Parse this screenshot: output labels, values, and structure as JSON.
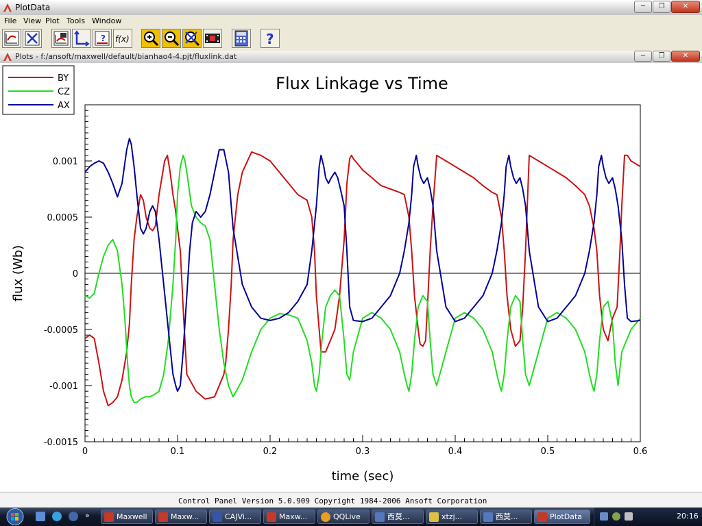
{
  "app": {
    "title": "PlotData"
  },
  "menu": [
    "File",
    "View",
    "Plot",
    "Tools",
    "Window"
  ],
  "toolbar": {
    "icons": [
      "plot-window-icon",
      "clear-plot-icon",
      "add-plot-icon",
      "axes-icon",
      "help-plot-icon",
      "function-icon",
      "zoom-in-icon",
      "zoom-out-icon",
      "zoom-fit-icon",
      "film-icon",
      "calculator-icon",
      "help-icon"
    ],
    "function_label": "f(x)",
    "help_label": "?"
  },
  "plot_window": {
    "title": "Plots - f:/ansoft/maxwell/default/bianhao4-4.pjt/fluxlink.dat"
  },
  "status": {
    "text": "Control Panel   Version 5.0.909   Copyright 1984-2006 Ansoft Corporation"
  },
  "taskbar": {
    "items": [
      "Maxwell",
      "Maxw...",
      "CAJVi...",
      "Maxw...",
      "QQLive",
      "西莫...",
      "xtzj...",
      "西莫...",
      "PlotData"
    ],
    "clock": "20:16"
  },
  "colors": {
    "BY": "#cc1111",
    "CZ": "#22dd22",
    "AX": "#000099"
  },
  "chart_data": {
    "type": "line",
    "title": "Flux Linkage vs Time",
    "xlabel": "time (sec)",
    "ylabel": "flux (Wb)",
    "xlim": [
      0,
      0.6
    ],
    "ylim": [
      -0.0015,
      0.0015
    ],
    "xticks": [
      "0",
      "0.1",
      "0.2",
      "0.3",
      "0.4",
      "0.5",
      "0.6"
    ],
    "yticks": [
      "0.001",
      "0.0005",
      "0",
      "-0.0005",
      "-0.001",
      "-0.0015"
    ],
    "series": [
      {
        "name": "BY",
        "color": "#cc1111",
        "x": [
          0,
          0.005,
          0.01,
          0.015,
          0.02,
          0.025,
          0.03,
          0.035,
          0.04,
          0.045,
          0.048,
          0.05,
          0.053,
          0.056,
          0.06,
          0.063,
          0.066,
          0.07,
          0.073,
          0.076,
          0.08,
          0.083,
          0.086,
          0.089,
          0.092,
          0.095,
          0.098,
          0.1,
          0.103,
          0.106,
          0.11,
          0.12,
          0.13,
          0.14,
          0.15,
          0.152,
          0.155,
          0.158,
          0.16,
          0.165,
          0.17,
          0.18,
          0.19,
          0.2,
          0.21,
          0.22,
          0.23,
          0.24,
          0.245,
          0.248,
          0.25,
          0.253,
          0.255,
          0.258,
          0.26,
          0.265,
          0.27,
          0.275,
          0.28,
          0.283,
          0.286,
          0.288,
          0.29,
          0.3,
          0.31,
          0.32,
          0.33,
          0.34,
          0.345,
          0.35,
          0.353,
          0.356,
          0.36,
          0.362,
          0.365,
          0.368,
          0.37,
          0.373,
          0.376,
          0.38,
          0.39,
          0.4,
          0.41,
          0.42,
          0.43,
          0.44,
          0.445,
          0.45,
          0.453,
          0.456,
          0.46,
          0.465,
          0.47,
          0.473,
          0.476,
          0.48,
          0.49,
          0.5,
          0.51,
          0.52,
          0.53,
          0.54,
          0.545,
          0.55,
          0.553,
          0.556,
          0.56,
          0.565,
          0.57,
          0.575,
          0.578,
          0.58,
          0.583,
          0.586,
          0.59,
          0.6
        ],
        "y": [
          -0.00058,
          -0.00055,
          -0.00058,
          -0.0008,
          -0.00105,
          -0.00118,
          -0.00115,
          -0.0011,
          -0.00095,
          -0.0007,
          -0.00045,
          -0.0001,
          0.0003,
          0.0005,
          0.0007,
          0.00065,
          0.0005,
          0.0004,
          0.00038,
          0.00042,
          0.0007,
          0.00085,
          0.001,
          0.00105,
          0.0009,
          0.0007,
          0.00055,
          0.0004,
          0.0002,
          -0.0003,
          -0.0009,
          -0.00105,
          -0.00112,
          -0.0011,
          -0.0009,
          -0.0008,
          -0.0005,
          -0.0001,
          0.0003,
          0.0007,
          0.0009,
          0.00108,
          0.00105,
          0.001,
          0.0009,
          0.0008,
          0.0007,
          0.00065,
          0.0005,
          0.0002,
          -0.0002,
          -0.0005,
          -0.0007,
          -0.0007,
          -0.0007,
          -0.0006,
          -0.0005,
          -0.0002,
          0.0003,
          0.0008,
          0.00102,
          0.00105,
          0.00102,
          0.00092,
          0.00085,
          0.00078,
          0.00075,
          0.00072,
          0.0007,
          0.0005,
          0.0002,
          -0.0002,
          -0.0005,
          -0.00063,
          -0.00065,
          -0.0006,
          -0.0003,
          0.0002,
          0.0006,
          0.00105,
          0.001,
          0.00095,
          0.0009,
          0.00085,
          0.00078,
          0.00072,
          0.0007,
          0.0005,
          0.0002,
          -0.0002,
          -0.0005,
          -0.00065,
          -0.0006,
          -0.0003,
          0.0002,
          0.00105,
          0.001,
          0.00095,
          0.0009,
          0.00085,
          0.00078,
          0.0007,
          0.0006,
          0.0004,
          0.0002,
          -0.0002,
          -0.0005,
          -0.0006,
          -0.0004,
          -0.0003,
          0.0002,
          0.0006,
          0.00105,
          0.00105,
          0.001,
          0.00095
        ]
      },
      {
        "name": "CZ",
        "color": "#22dd22",
        "x": [
          0,
          0.005,
          0.01,
          0.015,
          0.02,
          0.025,
          0.03,
          0.035,
          0.04,
          0.043,
          0.046,
          0.048,
          0.05,
          0.053,
          0.056,
          0.06,
          0.065,
          0.07,
          0.075,
          0.08,
          0.085,
          0.09,
          0.095,
          0.098,
          0.1,
          0.103,
          0.106,
          0.108,
          0.11,
          0.115,
          0.12,
          0.125,
          0.13,
          0.135,
          0.14,
          0.145,
          0.15,
          0.155,
          0.16,
          0.17,
          0.18,
          0.19,
          0.2,
          0.21,
          0.22,
          0.23,
          0.24,
          0.245,
          0.248,
          0.25,
          0.253,
          0.256,
          0.26,
          0.265,
          0.27,
          0.275,
          0.28,
          0.283,
          0.286,
          0.29,
          0.3,
          0.31,
          0.32,
          0.33,
          0.34,
          0.345,
          0.348,
          0.35,
          0.353,
          0.356,
          0.36,
          0.365,
          0.37,
          0.373,
          0.376,
          0.38,
          0.39,
          0.4,
          0.41,
          0.42,
          0.43,
          0.44,
          0.445,
          0.448,
          0.45,
          0.453,
          0.456,
          0.46,
          0.465,
          0.47,
          0.473,
          0.476,
          0.48,
          0.49,
          0.5,
          0.51,
          0.52,
          0.53,
          0.54,
          0.545,
          0.548,
          0.55,
          0.553,
          0.556,
          0.56,
          0.565,
          0.57,
          0.573,
          0.576,
          0.58,
          0.59,
          0.6
        ],
        "y": [
          -0.0002,
          -0.00022,
          -0.00018,
          0.0,
          0.00015,
          0.00025,
          0.0003,
          0.0002,
          -0.0001,
          -0.0004,
          -0.0008,
          -0.001,
          -0.0011,
          -0.00115,
          -0.00115,
          -0.00112,
          -0.0011,
          -0.0011,
          -0.00108,
          -0.00105,
          -0.0009,
          -0.0006,
          -0.0001,
          0.0003,
          0.0007,
          0.00095,
          0.00105,
          0.001,
          0.0009,
          0.0006,
          0.0005,
          0.00045,
          0.00042,
          0.0003,
          -0.0001,
          -0.0005,
          -0.0008,
          -0.001,
          -0.0011,
          -0.00095,
          -0.0007,
          -0.0005,
          -0.0004,
          -0.00036,
          -0.00037,
          -0.0004,
          -0.0006,
          -0.0008,
          -0.001,
          -0.00105,
          -0.0009,
          -0.0006,
          -0.0003,
          -0.0002,
          -0.00015,
          -0.0002,
          -0.0006,
          -0.0009,
          -0.00095,
          -0.0007,
          -0.0004,
          -0.00035,
          -0.0004,
          -0.0005,
          -0.0007,
          -0.0009,
          -0.001,
          -0.00105,
          -0.0009,
          -0.0006,
          -0.0003,
          -0.0002,
          -0.00025,
          -0.0006,
          -0.0009,
          -0.001,
          -0.0007,
          -0.0004,
          -0.00035,
          -0.0004,
          -0.0005,
          -0.0007,
          -0.0009,
          -0.001,
          -0.00105,
          -0.0009,
          -0.0006,
          -0.0003,
          -0.0002,
          -0.00025,
          -0.0006,
          -0.0009,
          -0.001,
          -0.0007,
          -0.0004,
          -0.00035,
          -0.0004,
          -0.0005,
          -0.0007,
          -0.0009,
          -0.001,
          -0.00105,
          -0.0009,
          -0.0006,
          -0.0003,
          -0.00025,
          -0.00045,
          -0.0008,
          -0.001,
          -0.0007,
          -0.0005,
          -0.0004
        ]
      },
      {
        "name": "AX",
        "color": "#000099",
        "x": [
          0,
          0.005,
          0.01,
          0.015,
          0.02,
          0.025,
          0.03,
          0.035,
          0.04,
          0.045,
          0.048,
          0.05,
          0.053,
          0.056,
          0.06,
          0.063,
          0.066,
          0.07,
          0.073,
          0.076,
          0.08,
          0.085,
          0.09,
          0.095,
          0.098,
          0.1,
          0.103,
          0.106,
          0.11,
          0.113,
          0.116,
          0.12,
          0.125,
          0.13,
          0.135,
          0.14,
          0.145,
          0.15,
          0.155,
          0.16,
          0.17,
          0.18,
          0.19,
          0.2,
          0.21,
          0.22,
          0.23,
          0.24,
          0.245,
          0.25,
          0.253,
          0.255,
          0.258,
          0.26,
          0.263,
          0.266,
          0.27,
          0.273,
          0.276,
          0.28,
          0.283,
          0.286,
          0.29,
          0.3,
          0.31,
          0.32,
          0.33,
          0.34,
          0.345,
          0.35,
          0.353,
          0.355,
          0.358,
          0.36,
          0.363,
          0.366,
          0.37,
          0.373,
          0.376,
          0.38,
          0.39,
          0.4,
          0.41,
          0.42,
          0.43,
          0.44,
          0.445,
          0.45,
          0.453,
          0.455,
          0.458,
          0.46,
          0.463,
          0.466,
          0.47,
          0.473,
          0.476,
          0.48,
          0.49,
          0.5,
          0.51,
          0.52,
          0.53,
          0.54,
          0.545,
          0.55,
          0.553,
          0.555,
          0.558,
          0.56,
          0.563,
          0.566,
          0.57,
          0.573,
          0.576,
          0.58,
          0.583,
          0.586,
          0.59,
          0.6
        ],
        "y": [
          0.0009,
          0.00095,
          0.00098,
          0.001,
          0.00098,
          0.0009,
          0.0008,
          0.00068,
          0.0008,
          0.0011,
          0.0012,
          0.00115,
          0.00095,
          0.0007,
          0.0004,
          0.00035,
          0.0004,
          0.00055,
          0.0006,
          0.00055,
          0.0003,
          -0.0001,
          -0.0005,
          -0.0009,
          -0.001,
          -0.00105,
          -0.001,
          -0.0007,
          -0.0002,
          0.0002,
          0.00045,
          0.00055,
          0.0005,
          0.00055,
          0.0007,
          0.0009,
          0.0011,
          0.0011,
          0.0009,
          0.0004,
          -0.0001,
          -0.0003,
          -0.0004,
          -0.00042,
          -0.0004,
          -0.00035,
          -0.00025,
          -0.0001,
          0.0002,
          0.0006,
          0.00095,
          0.00105,
          0.00095,
          0.00085,
          0.0008,
          0.00085,
          0.0009,
          0.00085,
          0.00075,
          0.0006,
          0.0002,
          -0.0003,
          -0.00042,
          -0.00043,
          -0.0004,
          -0.0003,
          -0.0002,
          0.0,
          0.0002,
          0.00045,
          0.0007,
          0.00095,
          0.00105,
          0.00095,
          0.00085,
          0.0008,
          0.00085,
          0.00075,
          0.0006,
          0.0002,
          -0.0003,
          -0.00043,
          -0.0004,
          -0.0003,
          -0.0002,
          0.0,
          0.0002,
          0.00045,
          0.0007,
          0.00095,
          0.00105,
          0.00095,
          0.00085,
          0.0008,
          0.00085,
          0.00075,
          0.0006,
          0.0002,
          -0.0003,
          -0.00043,
          -0.0004,
          -0.0003,
          -0.0002,
          0.0,
          0.0002,
          0.00045,
          0.0007,
          0.00095,
          0.00105,
          0.00095,
          0.00085,
          0.0008,
          0.00085,
          0.00075,
          0.0006,
          0.0003,
          -0.0001,
          -0.0004,
          -0.00043,
          -0.00042
        ]
      }
    ],
    "legend": [
      "BY",
      "CZ",
      "AX"
    ],
    "legend_position": "top-left"
  }
}
